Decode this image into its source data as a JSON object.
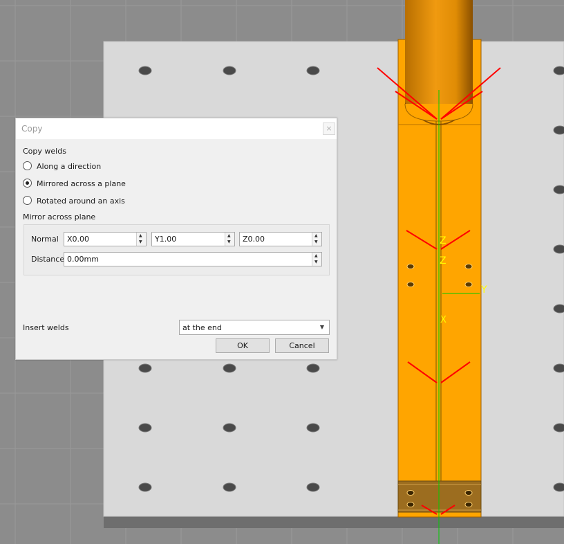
{
  "dialog": {
    "title": "Copy",
    "close_symbol": "×",
    "copy_welds_label": "Copy welds",
    "options": [
      {
        "label": "Along a direction",
        "checked": false
      },
      {
        "label": "Mirrored across a plane",
        "checked": true
      },
      {
        "label": "Rotated around an axis",
        "checked": false
      }
    ],
    "mirror_group_label": "Mirror across plane",
    "normal_label": "Normal",
    "normal_x": "X0.00",
    "normal_y": "Y1.00",
    "normal_z": "Z0.00",
    "distance_label": "Distance",
    "distance_value": "0.00mm",
    "insert_welds_label": "Insert welds",
    "insert_welds_value": "at the end",
    "ok_label": "OK",
    "cancel_label": "Cancel"
  },
  "viewport": {
    "axis_labels": {
      "z": "Z",
      "z2": "Z",
      "y": "Y",
      "x": "X"
    },
    "colors": {
      "background": "#8c8c8c",
      "plate": "#d9d9d9",
      "part": "#ffa500",
      "tube": "#d98a00",
      "weld": "#ff0000",
      "axis_y": "#00cc00",
      "axis_label": "#ffff00"
    }
  }
}
